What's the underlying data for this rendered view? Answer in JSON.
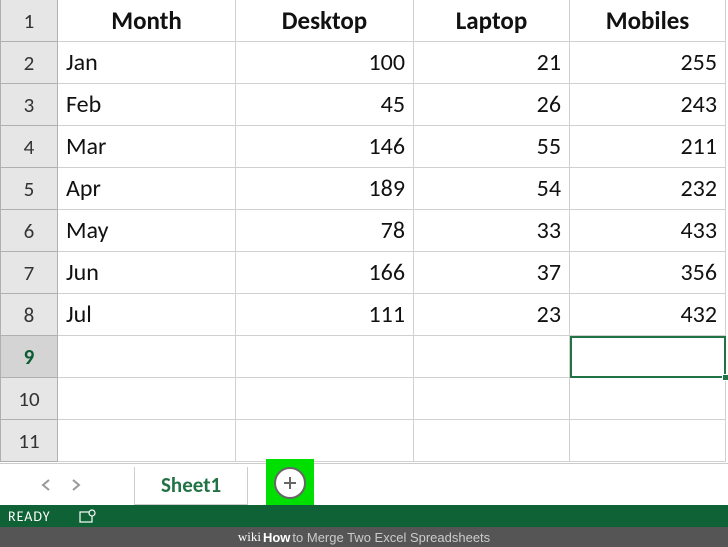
{
  "row_headers": [
    "1",
    "2",
    "3",
    "4",
    "5",
    "6",
    "7",
    "8",
    "9",
    "10",
    "11"
  ],
  "selected_row_index": 8,
  "columns": [
    "Month",
    "Desktop",
    "Laptop",
    "Mobiles"
  ],
  "rows": [
    {
      "month": "Jan",
      "desktop": "100",
      "laptop": "21",
      "mobiles": "255"
    },
    {
      "month": "Feb",
      "desktop": "45",
      "laptop": "26",
      "mobiles": "243"
    },
    {
      "month": "Mar",
      "desktop": "146",
      "laptop": "55",
      "mobiles": "211"
    },
    {
      "month": "Apr",
      "desktop": "189",
      "laptop": "54",
      "mobiles": "232"
    },
    {
      "month": "May",
      "desktop": "78",
      "laptop": "33",
      "mobiles": "433"
    },
    {
      "month": "Jun",
      "desktop": "166",
      "laptop": "37",
      "mobiles": "356"
    },
    {
      "month": "Jul",
      "desktop": "111",
      "laptop": "23",
      "mobiles": "432"
    }
  ],
  "sheet_tab": "Sheet1",
  "status": "READY",
  "watermark": {
    "prefix": "wiki",
    "mid": "How",
    "suffix": " to Merge Two Excel Spreadsheets"
  },
  "chart_data": {
    "type": "table",
    "columns": [
      "Month",
      "Desktop",
      "Laptop",
      "Mobiles"
    ],
    "data": [
      [
        "Jan",
        100,
        21,
        255
      ],
      [
        "Feb",
        45,
        26,
        243
      ],
      [
        "Mar",
        146,
        55,
        211
      ],
      [
        "Apr",
        189,
        54,
        232
      ],
      [
        "May",
        78,
        33,
        433
      ],
      [
        "Jun",
        166,
        37,
        356
      ],
      [
        "Jul",
        111,
        23,
        432
      ]
    ]
  }
}
